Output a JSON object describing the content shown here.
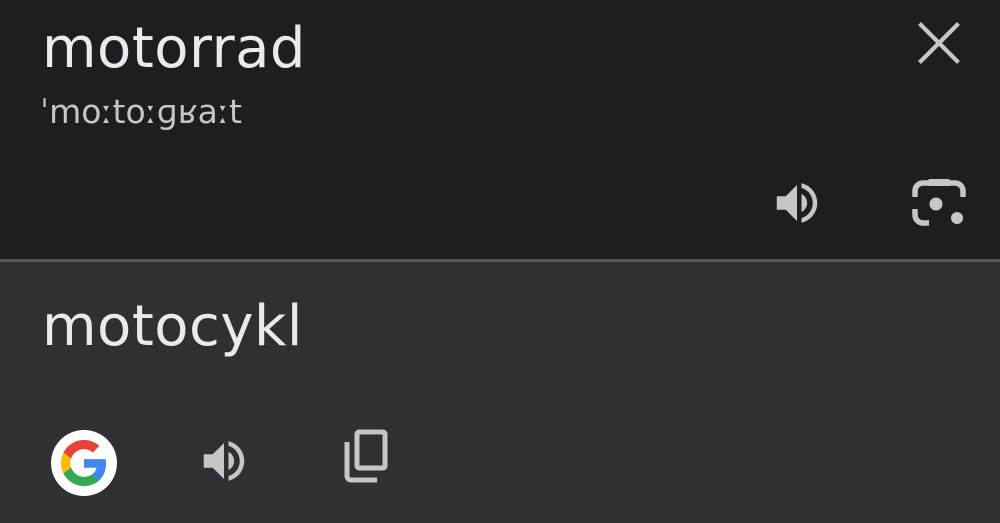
{
  "source": {
    "word": "motorrad",
    "phonetic": "ˈmoːtoːɡʁaːt",
    "icons": {
      "close": "close-icon",
      "speaker": "volume-up-icon",
      "lens": "google-lens-icon"
    }
  },
  "target": {
    "word": "motocykl",
    "icons": {
      "search": "google-g-icon",
      "speaker": "volume-up-icon",
      "copy": "copy-icon"
    }
  },
  "colors": {
    "source_bg": "#1e1e1f",
    "target_bg": "#2f3034",
    "divider": "#56575b",
    "text": "#e8eaed",
    "icon": "#c4c7c5"
  }
}
